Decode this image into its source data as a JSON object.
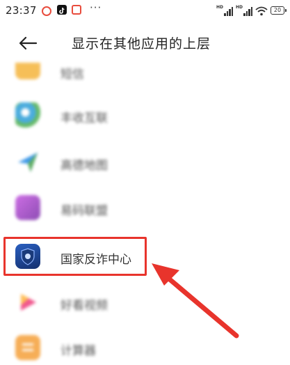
{
  "status_bar": {
    "time": "23:37",
    "more": "···",
    "signal_tag": "HD",
    "battery": "20"
  },
  "header": {
    "title": "显示在其他应用的上层",
    "back_icon": "arrow-left-icon"
  },
  "apps": [
    {
      "label": "短信",
      "icon": "messages-icon",
      "color": "#f5b43c",
      "blurred": true
    },
    {
      "label": "丰收互联",
      "icon": "bank-icon",
      "color": "#2b9ed8",
      "blurred": true
    },
    {
      "label": "高德地图",
      "icon": "map-icon",
      "color": "#1e88e5",
      "blurred": true
    },
    {
      "label": "易码联盟",
      "icon": "purple-app-icon",
      "color": "#9b3cc4",
      "blurred": true
    },
    {
      "label": "国家反诈中心",
      "icon": "anti-fraud-shield-icon",
      "color": "#1c3f8c",
      "blurred": false
    },
    {
      "label": "好看视频",
      "icon": "video-icon",
      "color": "#ee3a7a",
      "blurred": true
    },
    {
      "label": "计算器",
      "icon": "calculator-icon",
      "color": "#f5a03a",
      "blurred": true
    }
  ],
  "annotation": {
    "highlight_color": "#e8342c",
    "arrow_color": "#e8342c"
  }
}
